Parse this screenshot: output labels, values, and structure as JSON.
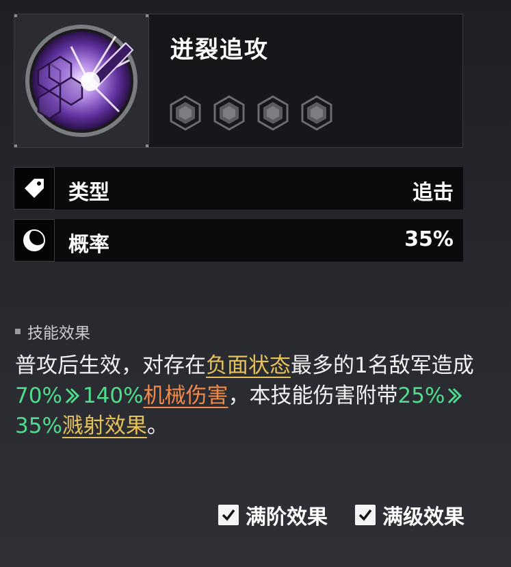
{
  "skill": {
    "title": "迸裂追攻",
    "star_count": 4,
    "icon": "purple-shield-burst-icon"
  },
  "attributes": [
    {
      "icon": "tag-icon",
      "label": "类型",
      "value": "追击"
    },
    {
      "icon": "moon-icon",
      "label": "概率",
      "value": "35%"
    }
  ],
  "section": {
    "title": "技能效果"
  },
  "description": {
    "p1": "普攻后生效，对存在",
    "kw1": "负面状态",
    "p2": "最多的1名敌军造成",
    "dmg_from": "70%",
    "dmg_to": "140%",
    "kw2": "机械伤害",
    "p3": "，本技能伤害附带",
    "splash_from": "25%",
    "splash_to": "35%",
    "kw3": "溅射效果",
    "p4": "。"
  },
  "toggles": [
    {
      "label": "满阶效果",
      "checked": true
    },
    {
      "label": "满级效果",
      "checked": true
    }
  ],
  "colors": {
    "keyword": "#e6c25a",
    "damage_type": "#f28a4c",
    "numbers": "#4fdc8c"
  }
}
